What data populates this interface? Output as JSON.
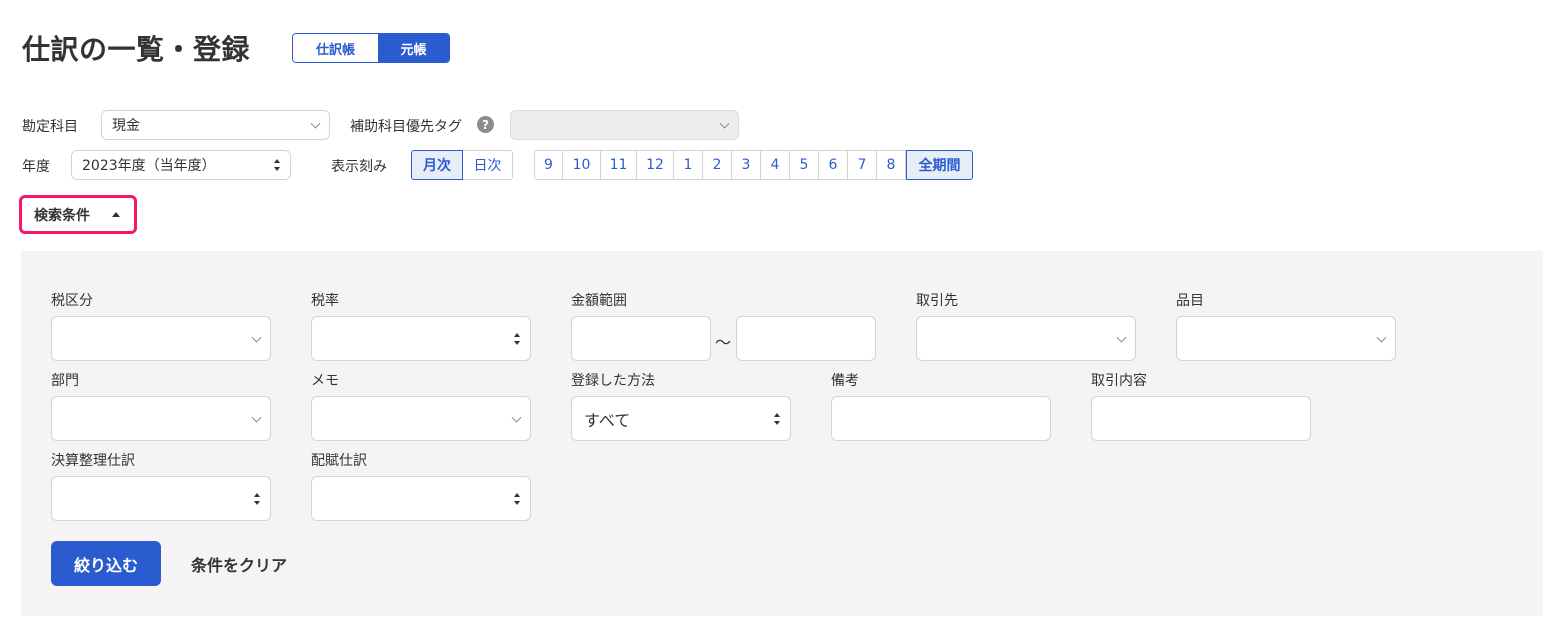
{
  "header": {
    "title": "仕訳の一覧・登録",
    "view_tabs": {
      "journal": "仕訳帳",
      "ledger": "元帳",
      "active": "元帳"
    }
  },
  "filters": {
    "account": {
      "label": "勘定科目",
      "value": "現金"
    },
    "sub_account_tag": {
      "label": "補助科目優先タグ",
      "value": "",
      "help_icon": "?"
    },
    "year": {
      "label": "年度",
      "value": "2023年度（当年度）"
    },
    "granularity": {
      "label": "表示刻み",
      "monthly": "月次",
      "daily": "日次",
      "selected": "月次"
    },
    "months": [
      "9",
      "10",
      "11",
      "12",
      "1",
      "2",
      "3",
      "4",
      "5",
      "6",
      "7",
      "8"
    ],
    "all_period": "全期間",
    "selected_period": "全期間"
  },
  "search": {
    "toggle_label": "検索条件",
    "expanded": true,
    "fields": {
      "tax_category": {
        "label": "税区分",
        "value": ""
      },
      "tax_rate": {
        "label": "税率",
        "value": ""
      },
      "amount_range": {
        "label": "金額範囲",
        "from": "",
        "to": "",
        "separator": "〜"
      },
      "partner": {
        "label": "取引先",
        "value": ""
      },
      "item": {
        "label": "品目",
        "value": ""
      },
      "department": {
        "label": "部門",
        "value": ""
      },
      "memo": {
        "label": "メモ",
        "value": ""
      },
      "registration_method": {
        "label": "登録した方法",
        "value": "すべて"
      },
      "remarks": {
        "label": "備考",
        "value": ""
      },
      "transaction_content": {
        "label": "取引内容",
        "value": ""
      },
      "closing_entry": {
        "label": "決算整理仕訳",
        "value": ""
      },
      "allocation_entry": {
        "label": "配賦仕訳",
        "value": ""
      }
    },
    "apply_label": "絞り込む",
    "clear_label": "条件をクリア"
  },
  "colors": {
    "accent": "#2b5ccf",
    "highlight_border": "#f0196e",
    "panel_bg": "#f5f3f3"
  },
  "icons": [
    "chevron-down-icon",
    "updown-arrows-icon",
    "help-icon",
    "caret-up-icon"
  ]
}
